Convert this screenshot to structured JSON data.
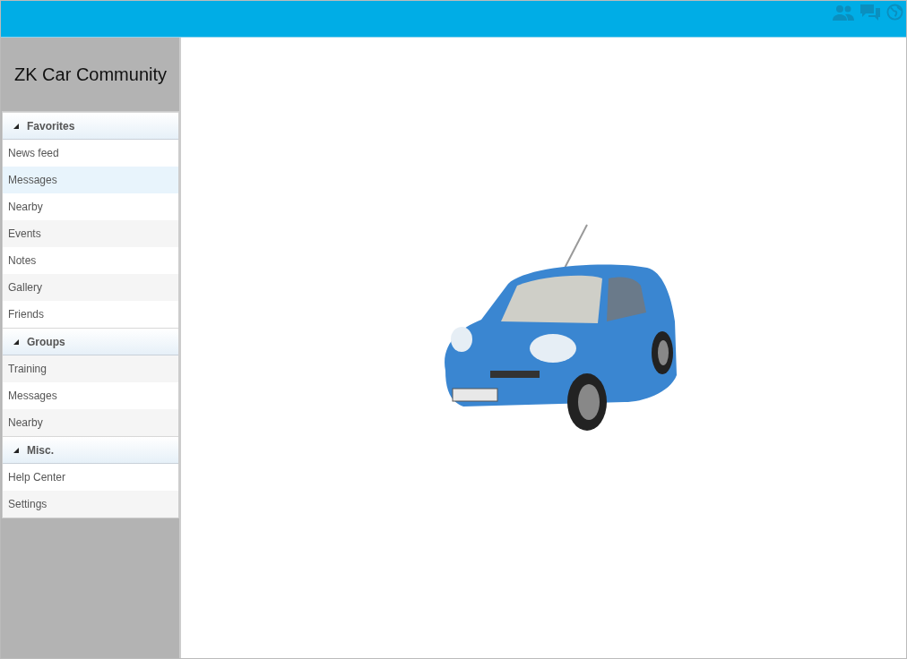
{
  "sidebar": {
    "title": "ZK Car Community",
    "groups": [
      {
        "label": "Favorites",
        "expanded": true,
        "items": [
          {
            "label": "News feed",
            "selected": false
          },
          {
            "label": "Messages",
            "selected": true
          },
          {
            "label": "Nearby",
            "selected": false
          },
          {
            "label": "Events",
            "selected": false
          },
          {
            "label": "Notes",
            "selected": false
          },
          {
            "label": "Gallery",
            "selected": false
          },
          {
            "label": "Friends",
            "selected": false
          }
        ]
      },
      {
        "label": "Groups",
        "expanded": true,
        "items": [
          {
            "label": "Training",
            "selected": false
          },
          {
            "label": "Messages",
            "selected": false
          },
          {
            "label": "Nearby",
            "selected": false
          }
        ]
      },
      {
        "label": "Misc.",
        "expanded": true,
        "items": [
          {
            "label": "Help Center",
            "selected": false
          },
          {
            "label": "Settings",
            "selected": false
          }
        ]
      }
    ]
  }
}
